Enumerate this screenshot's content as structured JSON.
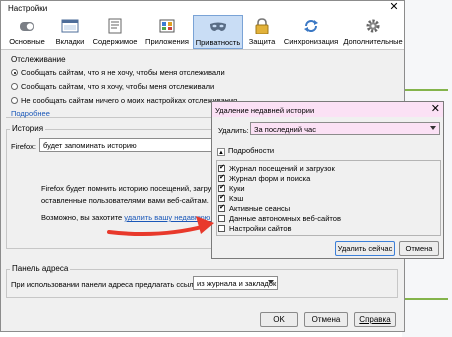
{
  "window": {
    "title": "Настройки"
  },
  "tabs": [
    {
      "label": "Основные",
      "icon": "general-switch-icon"
    },
    {
      "label": "Вкладки",
      "icon": "tabs-window-icon"
    },
    {
      "label": "Содержимое",
      "icon": "content-page-icon"
    },
    {
      "label": "Приложения",
      "icon": "applications-icon"
    },
    {
      "label": "Приватность",
      "icon": "privacy-mask-icon",
      "active": true
    },
    {
      "label": "Защита",
      "icon": "lock-icon"
    },
    {
      "label": "Синхронизация",
      "icon": "sync-icon"
    },
    {
      "label": "Дополнительные",
      "icon": "gear-icon"
    }
  ],
  "tracking": {
    "title": "Отслеживание",
    "options": [
      "Сообщать сайтам, что я не хочу, чтобы меня отслеживали",
      "Сообщать сайтам, что я хочу, чтобы меня отслеживали",
      "Не сообщать сайтам ничего о моих настройках отслеживания"
    ],
    "selected_index": 0,
    "more_link": "Подробнее"
  },
  "history": {
    "title": "История",
    "firefox_label": "Firefox:",
    "mode_value": "будет запоминать историю",
    "desc1": "Firefox будет помнить историю посещений, загрузок, пои",
    "desc2": "оставленные пользователями вами веб-сайтам.",
    "possible_text": "Возможно, вы захотите",
    "clear_link": "удалить вашу недавнюю историю"
  },
  "address_bar": {
    "title": "Панель адреса",
    "label": "При использовании панели адреса предлагать ссылки:",
    "value": "из журнала и закладок"
  },
  "buttons": {
    "ok": "OK",
    "cancel": "Отмена",
    "help": "Справка"
  },
  "dialog": {
    "title": "Удаление недавней истории",
    "range_label": "Удалить:",
    "range_value": "За последний час",
    "details_label": "Подробности",
    "items": [
      {
        "label": "Журнал посещений и загрузок",
        "checked": true
      },
      {
        "label": "Журнал форм и поиска",
        "checked": true
      },
      {
        "label": "Куки",
        "checked": true
      },
      {
        "label": "Кэш",
        "checked": true
      },
      {
        "label": "Активные сеансы",
        "checked": true
      },
      {
        "label": "Данные автономных веб-сайтов",
        "checked": false
      },
      {
        "label": "Настройки сайтов",
        "checked": false
      }
    ],
    "clear_now": "Удалить сейчас",
    "cancel": "Отмена"
  },
  "colors": {
    "dialog_title_bg": "#fbe1f5",
    "active_tab_bg": "#c9ddf5",
    "annotation_arrow": "#e8392b",
    "background_accent_green": "#84b44c",
    "link": "#1a57b8"
  }
}
